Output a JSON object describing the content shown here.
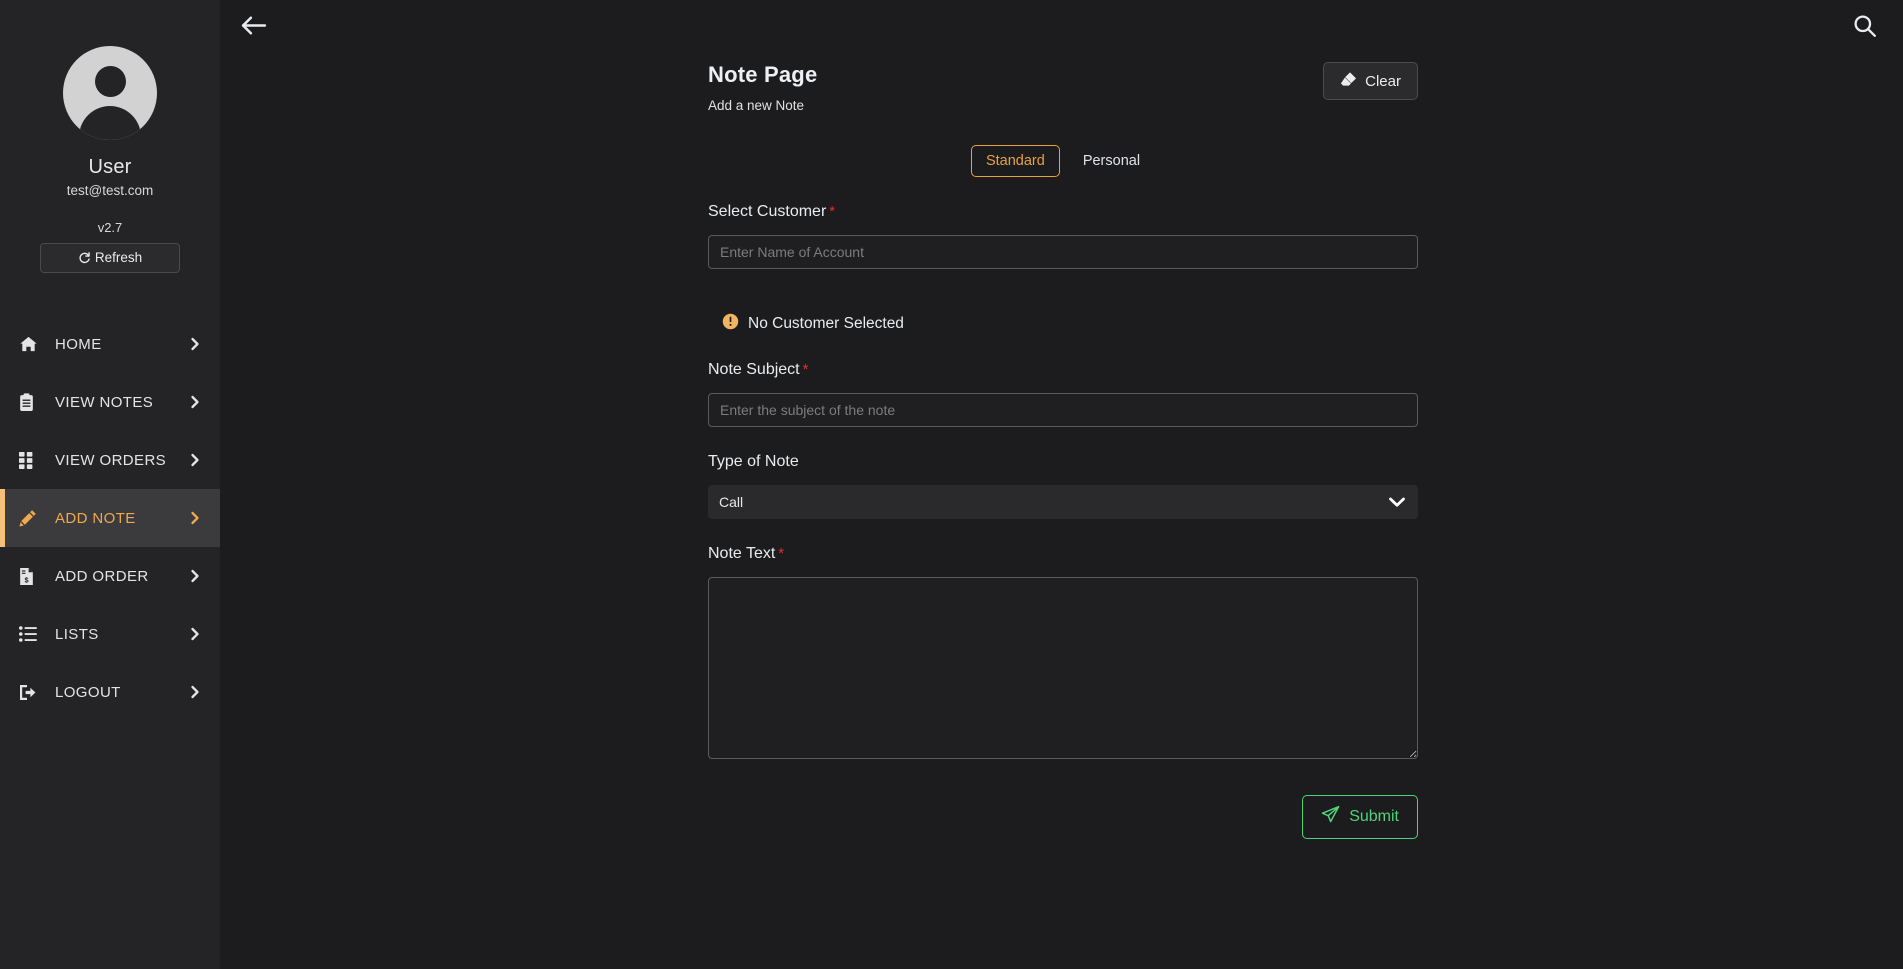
{
  "sidebar": {
    "avatar_icon": "user-avatar-icon",
    "username": "User",
    "email": "test@test.com",
    "version": "v2.7",
    "refresh_label": "Refresh",
    "refresh_icon": "refresh-icon",
    "items": [
      {
        "label": "HOME",
        "icon": "home-icon",
        "active": false
      },
      {
        "label": "VIEW NOTES",
        "icon": "clipboard-icon",
        "active": false
      },
      {
        "label": "VIEW ORDERS",
        "icon": "grid-icon",
        "active": false
      },
      {
        "label": "ADD NOTE",
        "icon": "pencil-icon",
        "active": true
      },
      {
        "label": "ADD ORDER",
        "icon": "invoice-icon",
        "active": false
      },
      {
        "label": "LISTS",
        "icon": "list-icon",
        "active": false
      },
      {
        "label": "LOGOUT",
        "icon": "sign-out-icon",
        "active": false
      }
    ],
    "chevron_icon": "chevron-right-icon"
  },
  "topbar": {
    "back_icon": "arrow-left-icon",
    "search_icon": "search-icon"
  },
  "page": {
    "title": "Note Page",
    "subtitle": "Add a new Note",
    "clear_label": "Clear",
    "clear_icon": "eraser-icon"
  },
  "tabs": [
    {
      "label": "Standard",
      "selected": true
    },
    {
      "label": "Personal",
      "selected": false
    }
  ],
  "form": {
    "customer": {
      "label": "Select Customer",
      "required_mark": "*",
      "placeholder": "Enter Name of Account",
      "value": ""
    },
    "alert": {
      "icon": "exclamation-circle-icon",
      "text": "No Customer Selected"
    },
    "subject": {
      "label": "Note Subject",
      "required_mark": "*",
      "placeholder": "Enter the subject of the note",
      "value": ""
    },
    "note_type": {
      "label": "Type of Note",
      "value": "Call",
      "options": [
        "Call"
      ],
      "chevron_icon": "chevron-down-icon"
    },
    "note_text": {
      "label": "Note Text",
      "required_mark": "*",
      "placeholder": "",
      "value": ""
    },
    "submit": {
      "label": "Submit",
      "icon": "paper-plane-icon"
    }
  },
  "colors": {
    "accent_orange": "#f0a84f",
    "accent_border": "#e8a13c",
    "required_red": "#f0272a",
    "submit_green": "#4fd37a",
    "sidebar_bg": "#242426",
    "main_bg": "#1c1c1e",
    "active_bg": "#3b3b3d"
  }
}
